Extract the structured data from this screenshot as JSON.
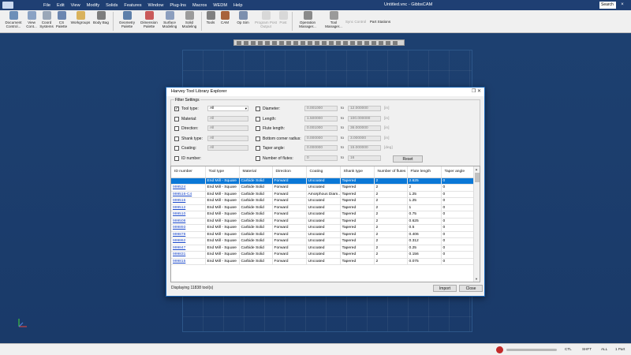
{
  "menubar": {
    "items": [
      "File",
      "Edit",
      "View",
      "Modify",
      "Solids",
      "Features",
      "Window",
      "Plug-Ins",
      "Macros",
      "WEDM",
      "Help"
    ],
    "title": "Untitled.vnc - GibbsCAM",
    "search_placeholder": "Search",
    "close_glyph": "×"
  },
  "toolbar": {
    "buttons": [
      {
        "label": "Document Control...",
        "icon": "document-icon"
      },
      {
        "label": "View Cont...",
        "icon": "view-icon"
      },
      {
        "label": "Coord Systems",
        "icon": "coord-icon"
      },
      {
        "label": "CS Palette",
        "icon": "cs-palette-icon"
      },
      {
        "label": "Workgroups",
        "icon": "workgroups-icon"
      },
      {
        "label": "Body Bag",
        "icon": "body-bag-icon"
      },
      {
        "label": "Geometry Palette",
        "icon": "geometry-icon"
      },
      {
        "label": "Dimension Palette",
        "icon": "dimension-icon"
      },
      {
        "label": "Surface Modeling",
        "icon": "surface-icon"
      },
      {
        "label": "Solid Modeling",
        "icon": "solid-icon"
      },
      {
        "label": "Tools",
        "icon": "tools-icon"
      },
      {
        "label": "CAM",
        "icon": "cam-icon"
      },
      {
        "label": "Op Sim",
        "icon": "op-sim-icon"
      },
      {
        "label": "Program Post Output",
        "icon": "program-icon",
        "disabled": true
      },
      {
        "label": "Post",
        "icon": "post-icon",
        "disabled": true
      },
      {
        "label": "Operation Manager...",
        "icon": "operation-icon"
      },
      {
        "label": "Tool Manager...",
        "icon": "tool-manager-icon"
      },
      {
        "label": "Sync Control",
        "icon": "sync-icon",
        "disabled": true
      },
      {
        "label": "Part Stations",
        "icon": "part-stations-icon"
      }
    ]
  },
  "dialog": {
    "title": "Harvey Tool Library Explorer",
    "filter_group": "Filter Settings",
    "left_filters": [
      {
        "label": "Tool type:",
        "value": "All",
        "checked": true
      },
      {
        "label": "Material:",
        "value": "All",
        "checked": false
      },
      {
        "label": "Direction:",
        "value": "All",
        "checked": false
      },
      {
        "label": "Shank type:",
        "value": "All",
        "checked": false
      },
      {
        "label": "Coating:",
        "value": "All",
        "checked": false
      },
      {
        "label": "ID number:",
        "value": "",
        "checked": false
      }
    ],
    "right_filters": [
      {
        "label": "Diameter:",
        "from": "0.001000",
        "to": "12.000000",
        "unit": "[in]"
      },
      {
        "label": "Length:",
        "from": "1.500000",
        "to": "100.000000",
        "unit": "[in]"
      },
      {
        "label": "Flute length:",
        "from": "0.001000",
        "to": "36.000000",
        "unit": "[in]"
      },
      {
        "label": "Bottom corner radius:",
        "from": "0.000000",
        "to": "3.000000",
        "unit": "[in]"
      },
      {
        "label": "Taper angle:",
        "from": "0.000000",
        "to": "15.000000",
        "unit": "[deg]"
      },
      {
        "label": "Number of flutes:",
        "from": "0",
        "to": "16",
        "unit": ""
      }
    ],
    "to_label": "to",
    "reset_label": "Reset",
    "columns": [
      "ID number",
      "Tool type",
      "Material",
      "Direction",
      "Coating",
      "Shank type",
      "Number of flutes",
      "Flute length",
      "Taper angle"
    ],
    "rows": [
      [
        "999526",
        "End Mill - Square",
        "Carbide Solid",
        "Forward",
        "Uncoated",
        "Tapered",
        "2",
        "2.625",
        "0"
      ],
      [
        "999524",
        "End Mill - Square",
        "Carbide Solid",
        "Forward",
        "Uncoated",
        "Tapered",
        "2",
        "2",
        "0"
      ],
      [
        "999516-C4",
        "End Mill - Square",
        "Carbide Solid",
        "Forward",
        "Amorphous Diam...",
        "Tapered",
        "2",
        "1.25",
        "0"
      ],
      [
        "999516",
        "End Mill - Square",
        "Carbide Solid",
        "Forward",
        "Uncoated",
        "Tapered",
        "2",
        "1.25",
        "0"
      ],
      [
        "999512",
        "End Mill - Square",
        "Carbide Solid",
        "Forward",
        "Uncoated",
        "Tapered",
        "2",
        "1",
        "0"
      ],
      [
        "999510",
        "End Mill - Square",
        "Carbide Solid",
        "Forward",
        "Uncoated",
        "Tapered",
        "2",
        "0.75",
        "0"
      ],
      [
        "999508",
        "End Mill - Square",
        "Carbide Solid",
        "Forward",
        "Uncoated",
        "Tapered",
        "2",
        "0.625",
        "0"
      ],
      [
        "999893",
        "End Mill - Square",
        "Carbide Solid",
        "Forward",
        "Uncoated",
        "Tapered",
        "2",
        "0.5",
        "0"
      ],
      [
        "999878",
        "End Mill - Square",
        "Carbide Solid",
        "Forward",
        "Uncoated",
        "Tapered",
        "2",
        "0.406",
        "0"
      ],
      [
        "999862",
        "End Mill - Square",
        "Carbide Solid",
        "Forward",
        "Uncoated",
        "Tapered",
        "2",
        "0.312",
        "0"
      ],
      [
        "999847",
        "End Mill - Square",
        "Carbide Solid",
        "Forward",
        "Uncoated",
        "Tapered",
        "2",
        "0.25",
        "0"
      ],
      [
        "999831",
        "End Mill - Square",
        "Carbide Solid",
        "Forward",
        "Uncoated",
        "Tapered",
        "2",
        "0.156",
        "0"
      ],
      [
        "999815",
        "End Mill - Square",
        "Carbide Solid",
        "Forward",
        "Uncoated",
        "Tapered",
        "2",
        "0.075",
        "0"
      ]
    ],
    "selected_row": 0,
    "status": "Displaying 11838 tool(s)",
    "import_label": "Import",
    "close_label": "Close"
  },
  "statusbar": {
    "items": [
      "CTL",
      "SHFT",
      "ALL",
      "1 Part"
    ]
  },
  "colors": {
    "desktop": "#1a3a6b",
    "selection": "#0a78d7",
    "link": "#1a47c8"
  }
}
